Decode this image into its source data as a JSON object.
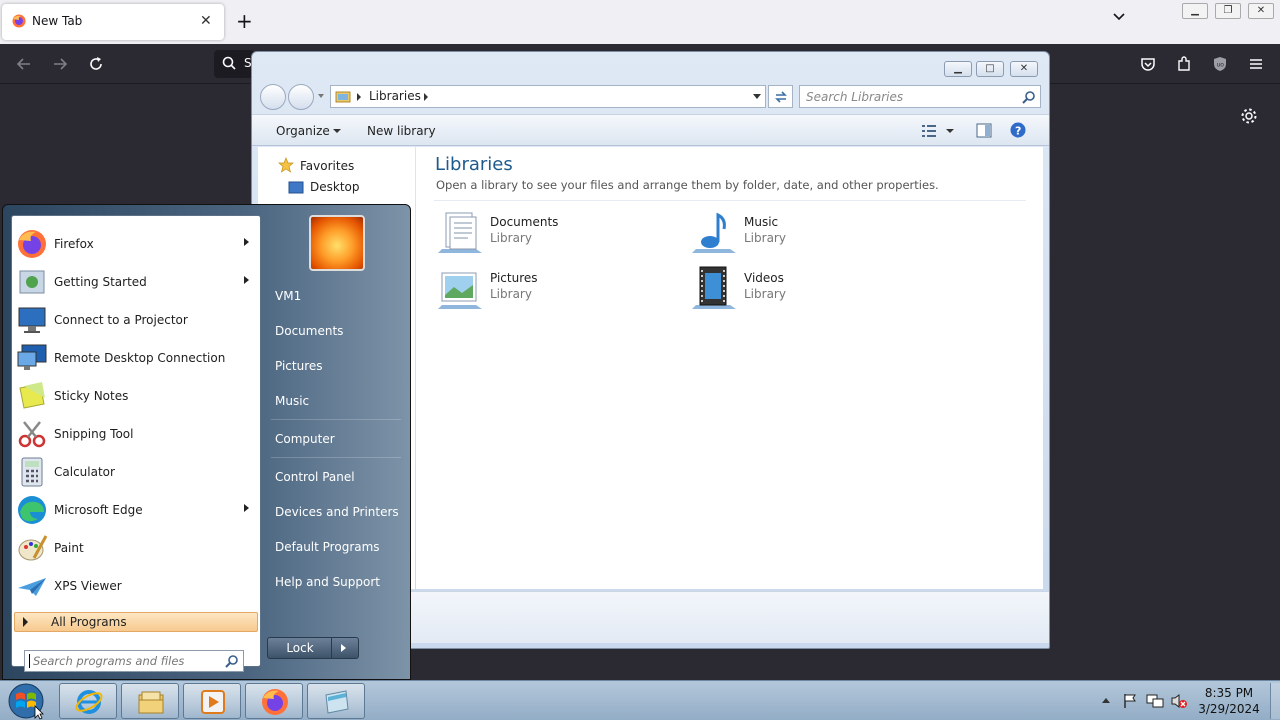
{
  "firefox": {
    "tab_title": "New Tab",
    "new_tab": "+",
    "urlbar_fragment": "S"
  },
  "explorer": {
    "breadcrumb": "Libraries",
    "search_placeholder": "Search Libraries",
    "organize": "Organize",
    "new_library": "New library",
    "nav": {
      "favorites": "Favorites",
      "desktop": "Desktop"
    },
    "heading": "Libraries",
    "description": "Open a library to see your files and arrange them by folder, date, and other properties.",
    "libraries": [
      {
        "name": "Documents",
        "type": "Library"
      },
      {
        "name": "Music",
        "type": "Library"
      },
      {
        "name": "Pictures",
        "type": "Library"
      },
      {
        "name": "Videos",
        "type": "Library"
      }
    ]
  },
  "start_menu": {
    "programs": [
      {
        "label": "Firefox",
        "has_submenu": true
      },
      {
        "label": "Getting Started",
        "has_submenu": true
      },
      {
        "label": "Connect to a Projector",
        "has_submenu": false
      },
      {
        "label": "Remote Desktop Connection",
        "has_submenu": false
      },
      {
        "label": "Sticky Notes",
        "has_submenu": false
      },
      {
        "label": "Snipping Tool",
        "has_submenu": false
      },
      {
        "label": "Calculator",
        "has_submenu": false
      },
      {
        "label": "Microsoft Edge",
        "has_submenu": true
      },
      {
        "label": "Paint",
        "has_submenu": false
      },
      {
        "label": "XPS Viewer",
        "has_submenu": false
      }
    ],
    "all_programs": "All Programs",
    "search_placeholder": "Search programs and files",
    "right_links": [
      "VM1",
      "Documents",
      "Pictures",
      "Music",
      "Computer",
      "Control Panel",
      "Devices and Printers",
      "Default Programs",
      "Help and Support"
    ],
    "lock": "Lock"
  },
  "taskbar": {
    "time": "8:35 PM",
    "date": "3/29/2024"
  },
  "colors": {
    "firefox_dark": "#2b2a33",
    "explorer_heading": "#1e5a8c",
    "all_programs_highlight": "#f7c98d"
  }
}
